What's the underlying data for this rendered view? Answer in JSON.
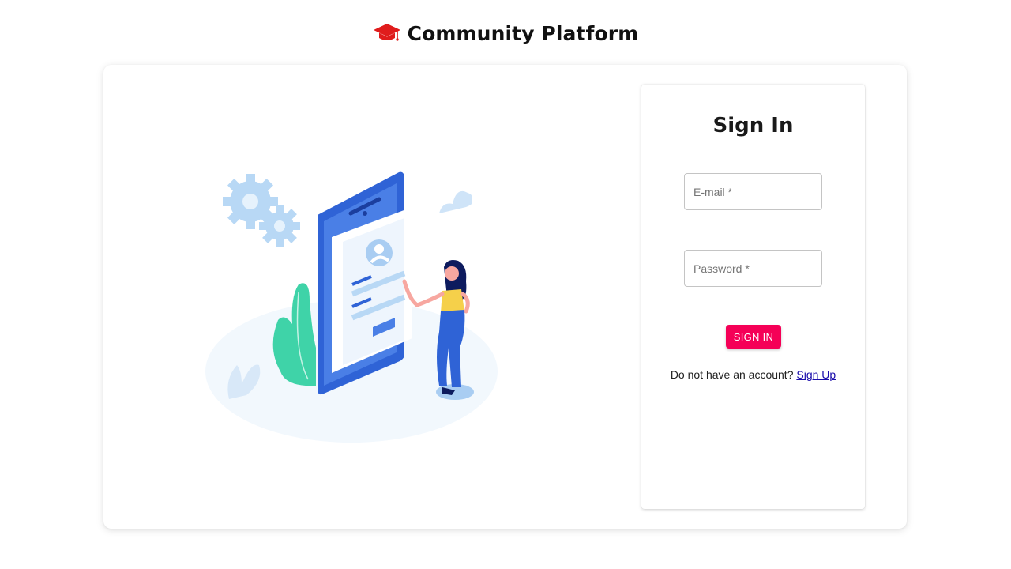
{
  "header": {
    "icon": "graduation-cap-icon",
    "title": "Community Platform",
    "icon_color": "#e01c1c"
  },
  "illustration": {
    "subject": "person-with-phone-login-illustration"
  },
  "signin": {
    "title": "Sign In",
    "email_placeholder": "E-mail *",
    "password_placeholder": "Password *",
    "button_label": "SIGN IN",
    "prompt_text": "Do not have an account?",
    "signup_link": "Sign Up"
  },
  "colors": {
    "accent": "#f50057",
    "link": "#1a0dab",
    "illustration_primary": "#2f63d6"
  }
}
